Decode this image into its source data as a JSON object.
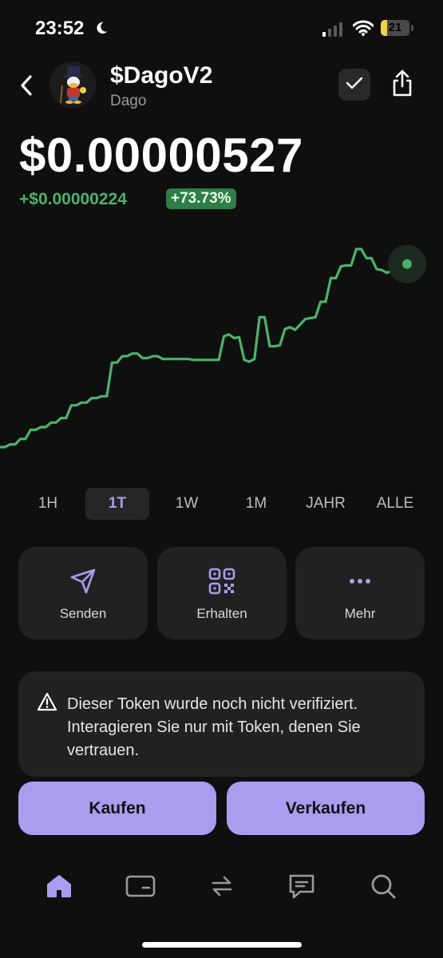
{
  "status_bar": {
    "time": "23:52",
    "battery": "21",
    "battery_level": 0.21,
    "moon_icon": "moon-icon",
    "signal_icon": "cellular-signal-icon",
    "wifi_icon": "wifi-icon"
  },
  "header": {
    "token_symbol": "$DagoV2",
    "token_name": "Dago",
    "back_icon": "chevron-left-icon",
    "check_icon": "checkmark-icon",
    "share_icon": "share-icon"
  },
  "price": {
    "current": "$0.00000527",
    "change_abs": "+$0.00000224",
    "change_pct": "+73.73%"
  },
  "chart_data": {
    "type": "line",
    "color": "#4cb26a",
    "values": [
      1.0,
      1.0,
      1.3,
      1.3,
      1.9,
      1.9,
      2.9,
      2.9,
      3.2,
      3.2,
      3.7,
      3.7,
      4.2,
      4.2,
      5.6,
      5.6,
      5.9,
      5.9,
      6.4,
      6.4,
      6.6,
      6.6,
      10.3,
      10.3,
      11.0,
      11.0,
      11.3,
      11.3,
      10.8,
      10.8,
      11.0,
      11.0,
      10.7,
      10.7,
      10.7,
      10.7,
      10.7,
      10.7,
      10.6,
      10.6,
      10.6,
      10.6,
      10.6,
      10.6,
      13.2,
      13.4,
      13.0,
      13.1,
      10.6,
      10.4,
      10.7,
      15.3,
      15.3,
      12.1,
      12.1,
      12.2,
      14.0,
      14.2,
      13.9,
      14.5,
      15.1,
      15.2,
      15.3,
      17.0,
      17.0,
      19.6,
      19.6,
      20.9,
      21.0,
      21.0,
      22.8,
      22.8,
      21.8,
      21.8,
      20.6,
      20.5,
      20.2,
      20.4,
      20.0,
      20.0,
      20.1
    ]
  },
  "ranges": [
    "1H",
    "1T",
    "1W",
    "1M",
    "JAHR",
    "ALLE"
  ],
  "active_range": "1T",
  "actions": [
    {
      "label": "Senden",
      "icon": "send-icon"
    },
    {
      "label": "Erhalten",
      "icon": "qr-code-icon"
    },
    {
      "label": "Mehr",
      "icon": "more-dots-icon"
    }
  ],
  "warning": {
    "text": "Dieser Token wurde noch nicht verifiziert. Interagieren Sie nur mit Token, denen Sie vertrauen.",
    "icon": "warning-triangle-icon"
  },
  "trade": {
    "buy": "Kaufen",
    "sell": "Verkaufen"
  },
  "tabbar": {
    "items": [
      "home-icon",
      "wallet-icon",
      "swap-icon",
      "chat-icon",
      "search-icon"
    ],
    "active": "home-icon"
  },
  "colors": {
    "accent": "#a99df0",
    "positive": "#4cb26a",
    "background": "#0f0f0f",
    "card": "#212121"
  }
}
